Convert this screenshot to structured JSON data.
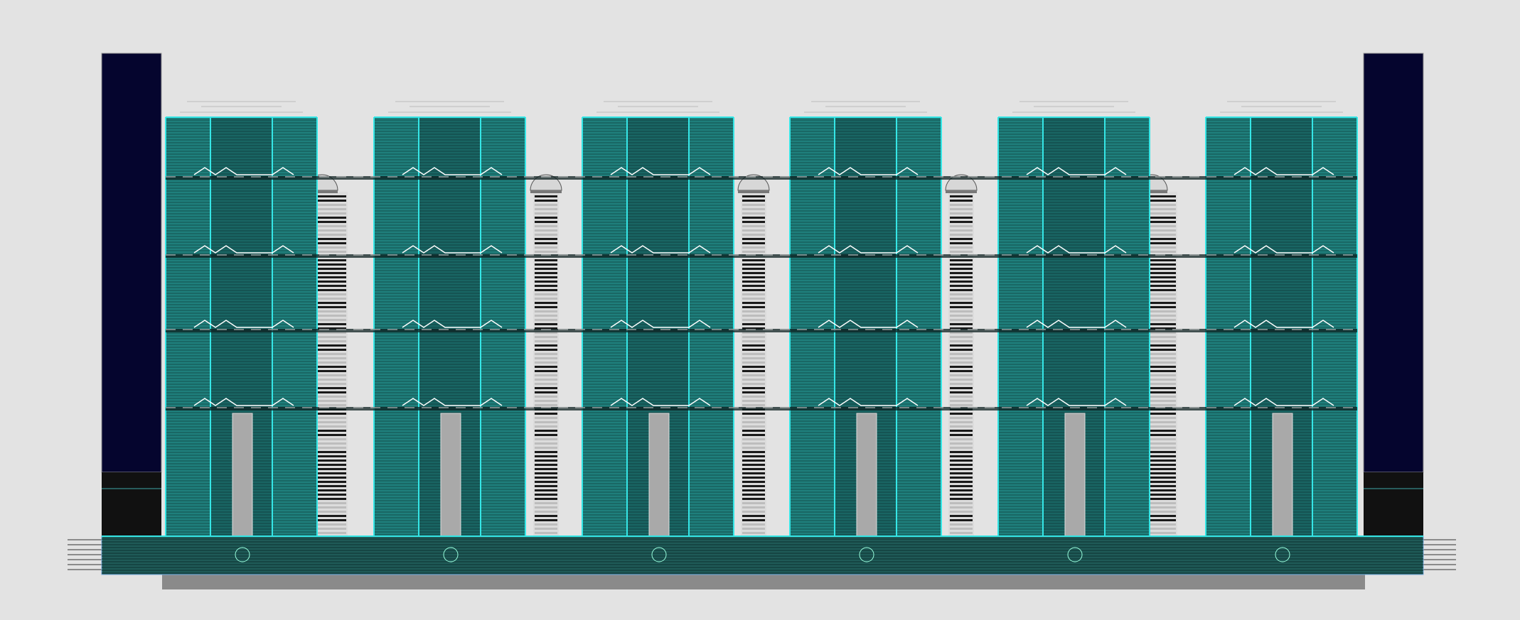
{
  "drawing": {
    "kind": "building facade elevation",
    "modules": 6,
    "floors": 5,
    "cores": 5,
    "pilotis": 6,
    "colors": {
      "background": "#e3e3e3",
      "tower": "#05052e",
      "tower_base": "#111111",
      "glass_fill": "#1f7f7c",
      "glass_dark": "#14504e",
      "frame": "#35e6e6",
      "louver": "#0b2a2a",
      "podium": "#1f5a57",
      "slab": "#8a8a8a",
      "column": "#a9a9a9",
      "core_light": "#dcdcdc",
      "core_dark": "#1a1a1a",
      "railing": "#ffffff"
    }
  }
}
